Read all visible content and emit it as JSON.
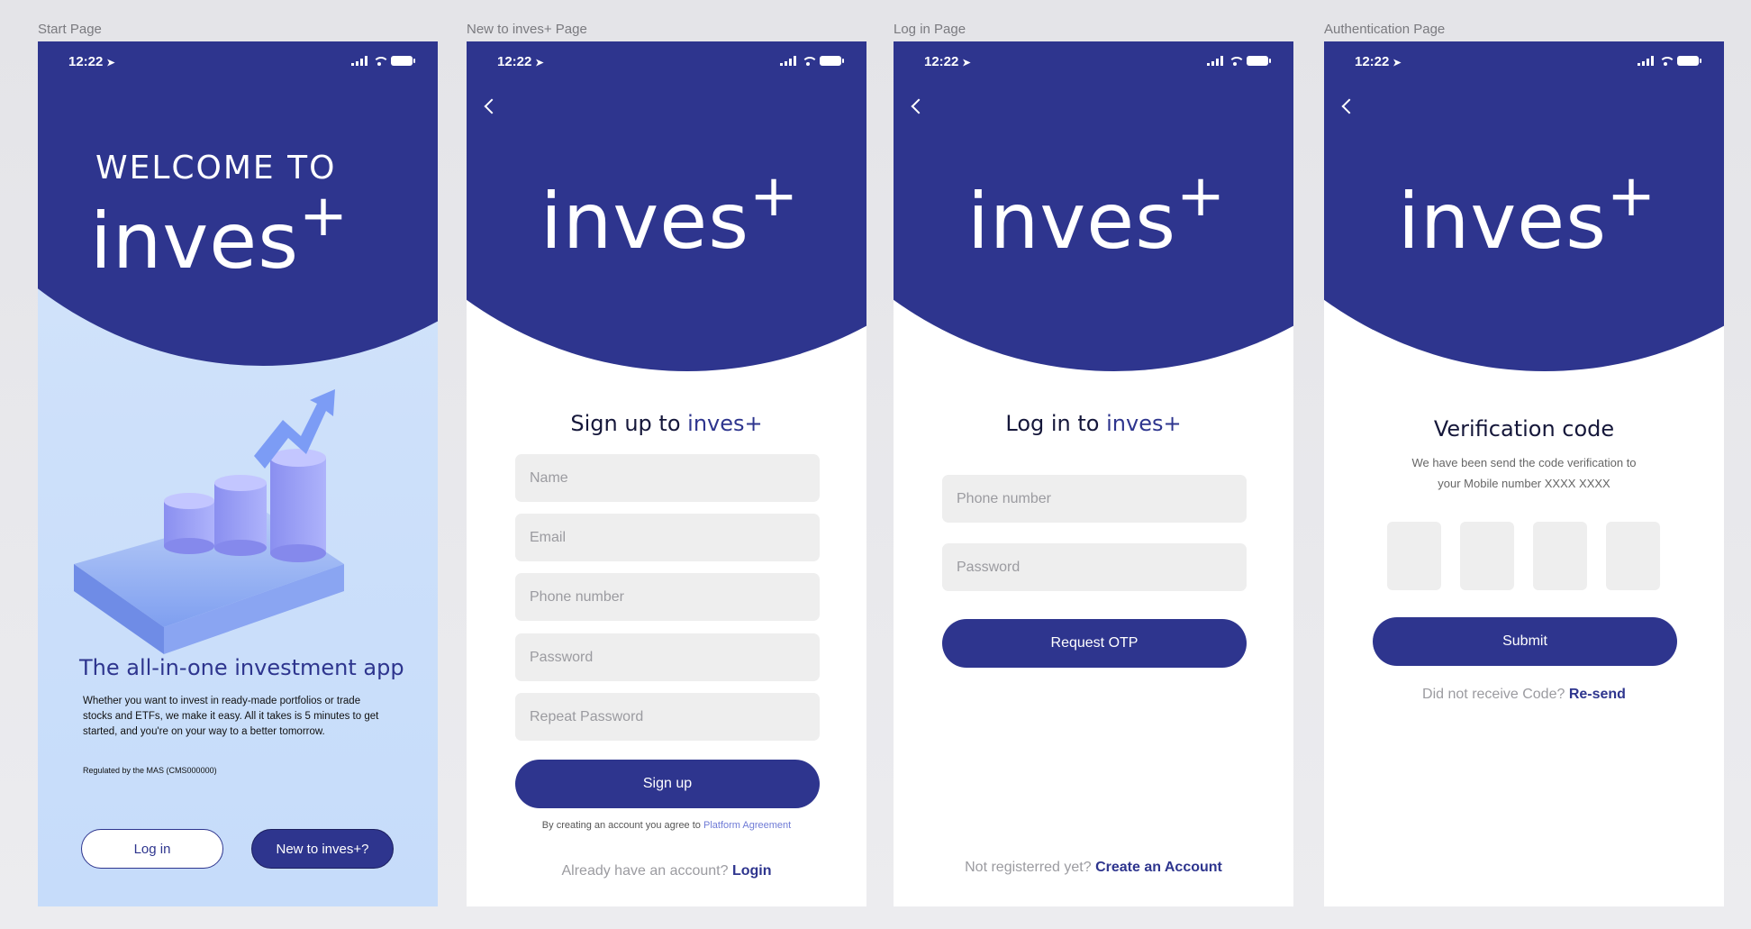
{
  "frames": {
    "start": "Start Page",
    "signup": "New to inves+ Page",
    "login": "Log in Page",
    "auth": "Authentication Page"
  },
  "status": {
    "time": "12:22",
    "location_arrow": "➤"
  },
  "brand": {
    "name": "inves",
    "plus": "+",
    "color": "#2e358e"
  },
  "start": {
    "welcome": "WELCOME TO",
    "tagline": "The all-in-one investment app",
    "description": "Whether you want to invest in ready-made portfolios or trade stocks and ETFs, we make it easy. All it takes is 5 minutes to get started, and you're on your way to a better tomorrow.",
    "regulated": "Regulated by the MAS (CMS000000)",
    "login_label": "Log in",
    "new_label": "New to inves+?"
  },
  "signup": {
    "heading_prefix": "Sign up to",
    "heading_brand": "inves+",
    "name_placeholder": "Name",
    "email_placeholder": "Email",
    "phone_placeholder": "Phone number",
    "password_placeholder": "Password",
    "repeat_placeholder": "Repeat Password",
    "button": "Sign up",
    "agree_text": "By creating an account you agree to",
    "agreement_link": "Platform Agreement",
    "have_account": "Already have an account?",
    "login_link": "Login"
  },
  "login": {
    "heading_prefix": "Log in to",
    "heading_brand": "inves+",
    "phone_placeholder": "Phone number",
    "password_placeholder": "Password",
    "button": "Request OTP",
    "not_registered": "Not registerred yet?",
    "create_link": "Create an Account"
  },
  "auth": {
    "heading": "Verification code",
    "desc_line1": "We have been send the code verification to",
    "desc_line2": "your Mobile number XXXX XXXX",
    "button": "Submit",
    "no_code": "Did not receive Code?",
    "resend_link": "Re-send"
  }
}
